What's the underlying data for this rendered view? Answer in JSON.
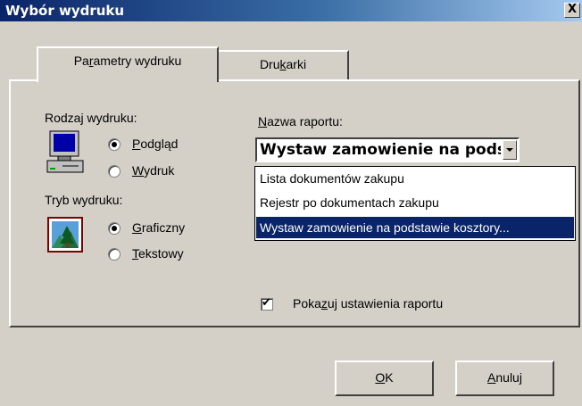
{
  "window": {
    "title": "Wybór wydruku",
    "close_glyph": "X"
  },
  "tabs": [
    {
      "label": "Parametry wydruku",
      "pre": "Pa",
      "acc": "r",
      "post": "ametry wydruku",
      "active": true
    },
    {
      "label": "Drukarki",
      "pre": "Dru",
      "acc": "k",
      "post": "arki",
      "active": false
    }
  ],
  "print_type": {
    "label": "Rodzaj wydruku:",
    "options": [
      {
        "acc": "P",
        "rest": "odgląd",
        "selected": true
      },
      {
        "acc": "W",
        "rest": "ydruk",
        "selected": false
      }
    ],
    "icon": "computer-icon"
  },
  "print_mode": {
    "label": "Tryb wydruku:",
    "options": [
      {
        "acc": "G",
        "rest": "raficzny",
        "selected": true
      },
      {
        "acc": "T",
        "rest": "ekstowy",
        "selected": false
      }
    ],
    "icon": "picture-icon"
  },
  "report": {
    "label_acc": "N",
    "label_rest": "azwa raportu:",
    "selected": "Wystaw zamowienie na podst...",
    "options": [
      "Lista dokumentów zakupu",
      "Rejestr po dokumentach zakupu",
      "Wystaw zamowienie na podstawie kosztory..."
    ],
    "selected_index": 2
  },
  "show_settings": {
    "pre": "Poka",
    "acc": "z",
    "post": "uj ustawienia raportu",
    "checked": true
  },
  "buttons": {
    "ok_acc": "O",
    "ok_rest": "K",
    "cancel_acc": "A",
    "cancel_rest": "nuluj"
  },
  "colors": {
    "title_bar": "#0a246a",
    "selection": "#0a246a",
    "face": "#d4d0c8"
  }
}
